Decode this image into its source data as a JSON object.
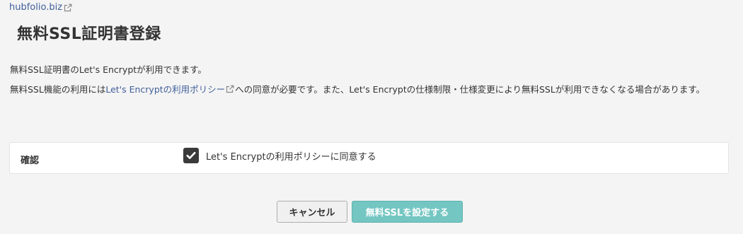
{
  "domain": {
    "label": "hubfolio.biz",
    "icon": "external-link-icon"
  },
  "page": {
    "title": "無料SSL証明書登録"
  },
  "description": {
    "line1": "無料SSL証明書のLet's Encryptが利用できます。",
    "line2_prefix": "無料SSL機能の利用には",
    "policy_link": "Let's Encryptの利用ポリシー",
    "line2_suffix": "への同意が必要です。また、Let's Encryptの仕様制限・仕様変更により無料SSLが利用できなくなる場合があります。"
  },
  "confirm": {
    "label": "確認",
    "checkbox_checked": true,
    "checkbox_label": "Let's Encryptの利用ポリシーに同意する"
  },
  "buttons": {
    "cancel": "キャンセル",
    "submit": "無料SSLを設定する"
  },
  "colors": {
    "link": "#3f5e9a",
    "submit_bg": "#74c6c2",
    "checkbox_bg": "#3a3a3a",
    "page_bg": "#f4f4f4"
  }
}
